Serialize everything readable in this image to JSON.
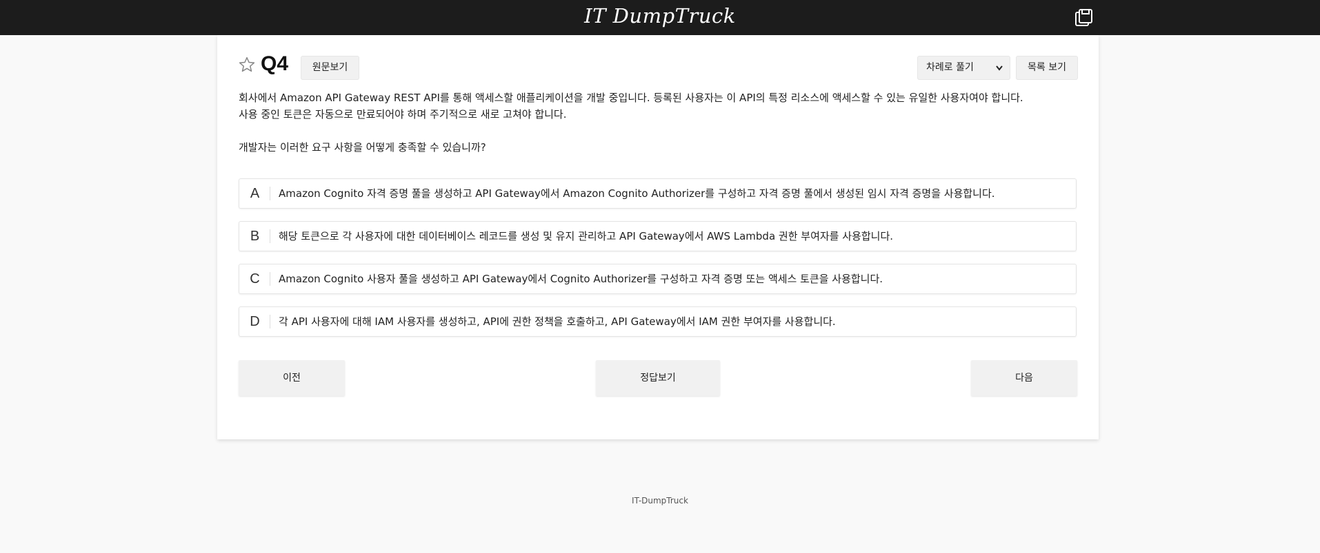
{
  "header": {
    "brand": "IT DumpTruck",
    "save_icon": "save-icon"
  },
  "question": {
    "number": "Q4",
    "favorite_icon": "star-icon",
    "source_button": "원문보기",
    "mode_select": {
      "selected": "차례로 풀기",
      "icon": "chevron-down-icon"
    },
    "list_button": "목록 보기",
    "text_line1": "회사에서 Amazon API Gateway REST API를 통해 액세스할 애플리케이션을 개발 중입니다. 등록된 사용자는 이 API의 특정 리소스에 액세스할 수 있는 유일한 사용자여야 합니다.",
    "text_line2": "사용 중인 토큰은 자동으로 만료되어야 하며 주기적으로 새로 고쳐야 합니다.",
    "prompt": "개발자는 이러한 요구 사항을 어떻게 충족할 수 있습니까?"
  },
  "options": [
    {
      "letter": "A",
      "text": "Amazon Cognito 자격 증명 풀을 생성하고 API Gateway에서 Amazon Cognito Authorizer를 구성하고 자격 증명 풀에서 생성된 임시 자격 증명을 사용합니다."
    },
    {
      "letter": "B",
      "text": "해당 토큰으로 각 사용자에 대한 데이터베이스 레코드를 생성 및 유지 관리하고 API Gateway에서 AWS Lambda 권한 부여자를 사용합니다."
    },
    {
      "letter": "C",
      "text": "Amazon Cognito 사용자 풀을 생성하고 API Gateway에서 Cognito Authorizer를 구성하고 자격 증명 또는 액세스 토큰을 사용합니다."
    },
    {
      "letter": "D",
      "text": "각 API 사용자에 대해 IAM 사용자를 생성하고, API에 권한 정책을 호출하고, API Gateway에서 IAM 권한 부여자를 사용합니다."
    }
  ],
  "navigation": {
    "prev": "이전",
    "show_answer": "정답보기",
    "next": "다음"
  },
  "footer": {
    "text": "IT-DumpTruck"
  }
}
